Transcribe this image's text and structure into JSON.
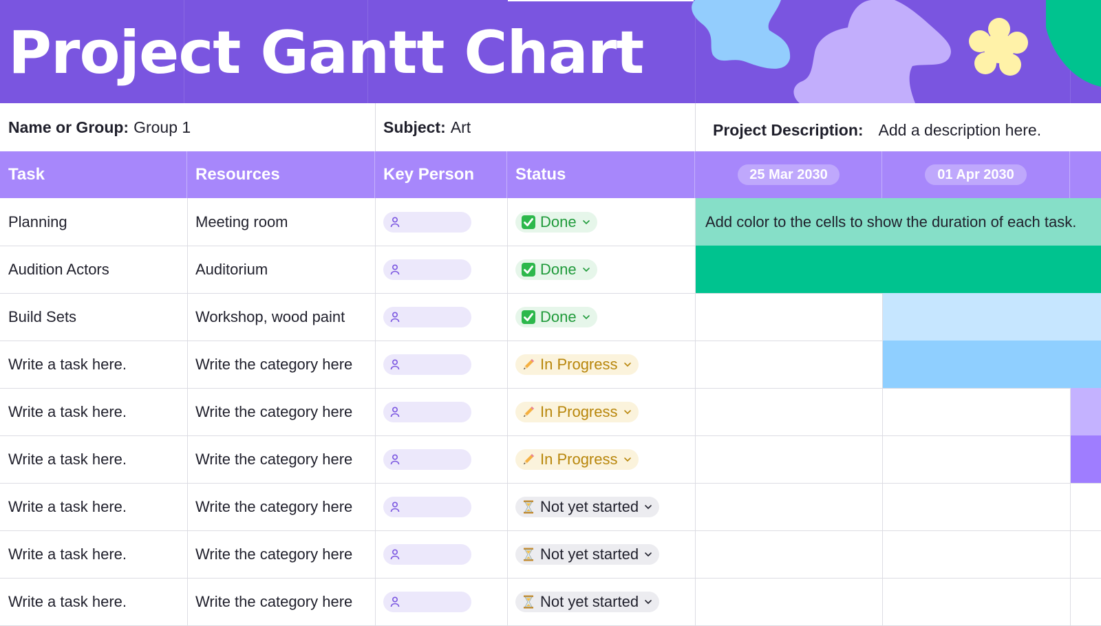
{
  "header": {
    "title": "Project Gantt Chart"
  },
  "info": {
    "name_label": "Name or Group:",
    "name_value": "Group 1",
    "subject_label": "Subject:",
    "subject_value": "Art",
    "description_label": "Project Description:",
    "description_value": "Add a description here."
  },
  "table": {
    "columns": [
      "Task",
      "Resources",
      "Key Person",
      "Status"
    ],
    "dates": [
      "25 Mar 2030",
      "01 Apr 2030"
    ],
    "bar_hint": "Add color to the cells to show the duration of each task.",
    "rows": [
      {
        "task": "Planning",
        "resource": "Meeting room",
        "status": "Done"
      },
      {
        "task": "Audition Actors",
        "resource": "Auditorium",
        "status": "Done"
      },
      {
        "task": "Build Sets",
        "resource": "Workshop, wood paint",
        "status": "Done"
      },
      {
        "task": "Write a task here.",
        "resource": "Write the category here",
        "status": "In Progress"
      },
      {
        "task": "Write a task here.",
        "resource": "Write the category here",
        "status": "In Progress"
      },
      {
        "task": "Write a task here.",
        "resource": "Write the category here",
        "status": "In Progress"
      },
      {
        "task": "Write a task here.",
        "resource": "Write the category here",
        "status": "Not yet started"
      },
      {
        "task": "Write a task here.",
        "resource": "Write the category here",
        "status": "Not yet started"
      },
      {
        "task": "Write a task here.",
        "resource": "Write the category here",
        "status": "Not yet started"
      }
    ]
  },
  "icons": {
    "person": "person-icon",
    "done": "check-box-icon",
    "in_progress": "pencil-icon",
    "not_started": "hourglass-icon",
    "dropdown": "chevron-down-icon"
  },
  "colors": {
    "header_bg": "#7a55e0",
    "table_header_bg": "#a787fb",
    "bar_teal_light": "#86dfc8",
    "bar_teal": "#00c38f",
    "bar_blue_light": "#c6e6ff",
    "bar_blue": "#8fcfff",
    "bar_purple_light": "#c4b2ff",
    "bar_purple": "#9f7dff",
    "deco_blue": "#93cdfd",
    "deco_lilac": "#c2aefc",
    "deco_yellow": "#fff2a8",
    "deco_green": "#00c38f"
  }
}
